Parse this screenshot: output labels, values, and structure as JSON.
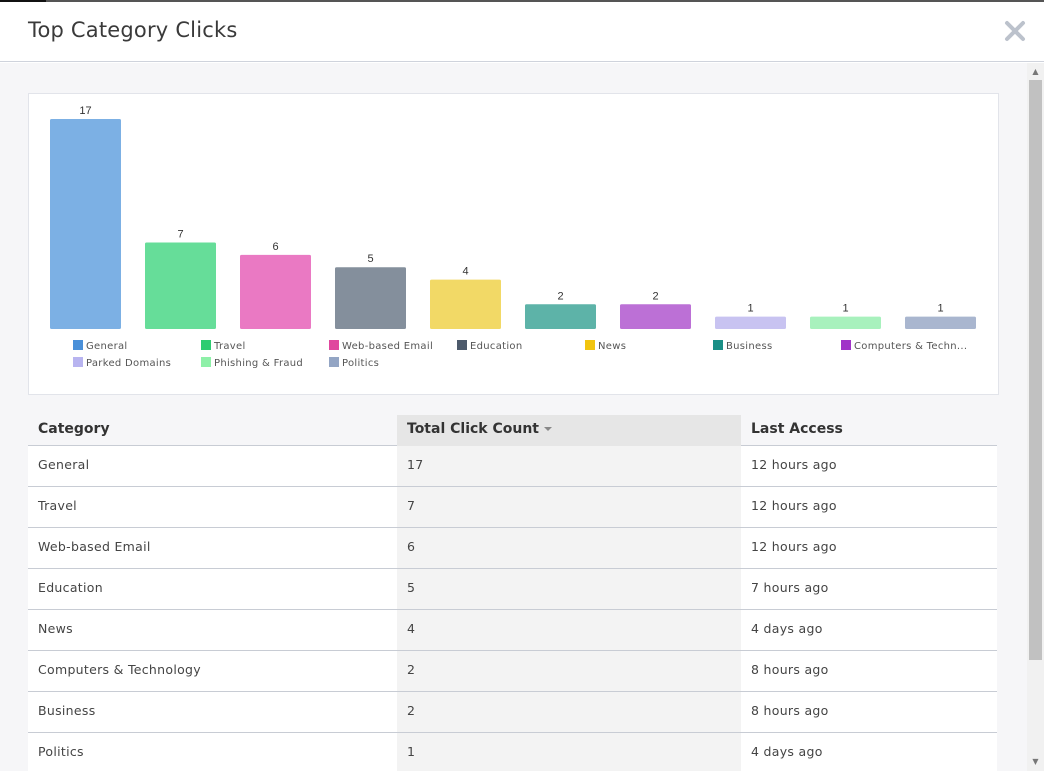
{
  "dialog": {
    "title": "Top Category Clicks"
  },
  "colors": {
    "header_border": "#cfd3dc",
    "body_bg": "#f6f6f8",
    "close_icon": "#bcc2cc"
  },
  "icons": {
    "close": "close-icon",
    "sort": "sort-desc-caret-icon"
  },
  "chart_data": {
    "type": "bar",
    "categories": [
      "General",
      "Travel",
      "Web-based Email",
      "Education",
      "News",
      "Business",
      "Computers & Techn...",
      "Parked Domains",
      "Phishing & Fraud",
      "Politics"
    ],
    "values": [
      17,
      7,
      6,
      5,
      4,
      2,
      2,
      1,
      1,
      1
    ],
    "colors": [
      "#7cb0e4",
      "#66dd99",
      "#ea79c3",
      "#848f9c",
      "#f2d966",
      "#5db3a8",
      "#bc70d6",
      "#c8c3f1",
      "#a8f1bd",
      "#a9b6cf"
    ],
    "legend": [
      {
        "label": "General",
        "color": "#4a90d9"
      },
      {
        "label": "Travel",
        "color": "#2ecc71"
      },
      {
        "label": "Web-based Email",
        "color": "#e0479e"
      },
      {
        "label": "Education",
        "color": "#4d5a6b"
      },
      {
        "label": "News",
        "color": "#f1c40f"
      },
      {
        "label": "Business",
        "color": "#1a8f86"
      },
      {
        "label": "Computers & Techn...",
        "color": "#a033c8"
      },
      {
        "label": "Parked Domains",
        "color": "#b8b4f0"
      },
      {
        "label": "Phishing & Fraud",
        "color": "#8ef0a8"
      },
      {
        "label": "Politics",
        "color": "#93a5c4"
      }
    ],
    "ylim": [
      0,
      17
    ],
    "grid": false,
    "legend_position": "bottom",
    "show_data_labels": true
  },
  "table": {
    "columns": [
      {
        "label": "Category",
        "sorted": false
      },
      {
        "label": "Total Click Count",
        "sorted": true
      },
      {
        "label": "Last Access",
        "sorted": false
      }
    ],
    "rows": [
      {
        "category": "General",
        "count": "17",
        "last": "12 hours ago"
      },
      {
        "category": "Travel",
        "count": "7",
        "last": "12 hours ago"
      },
      {
        "category": "Web-based Email",
        "count": "6",
        "last": "12 hours ago"
      },
      {
        "category": "Education",
        "count": "5",
        "last": "7 hours ago"
      },
      {
        "category": "News",
        "count": "4",
        "last": "4 days ago"
      },
      {
        "category": "Computers & Technology",
        "count": "2",
        "last": "8 hours ago"
      },
      {
        "category": "Business",
        "count": "2",
        "last": "8 hours ago"
      },
      {
        "category": "Politics",
        "count": "1",
        "last": "4 days ago"
      }
    ]
  }
}
